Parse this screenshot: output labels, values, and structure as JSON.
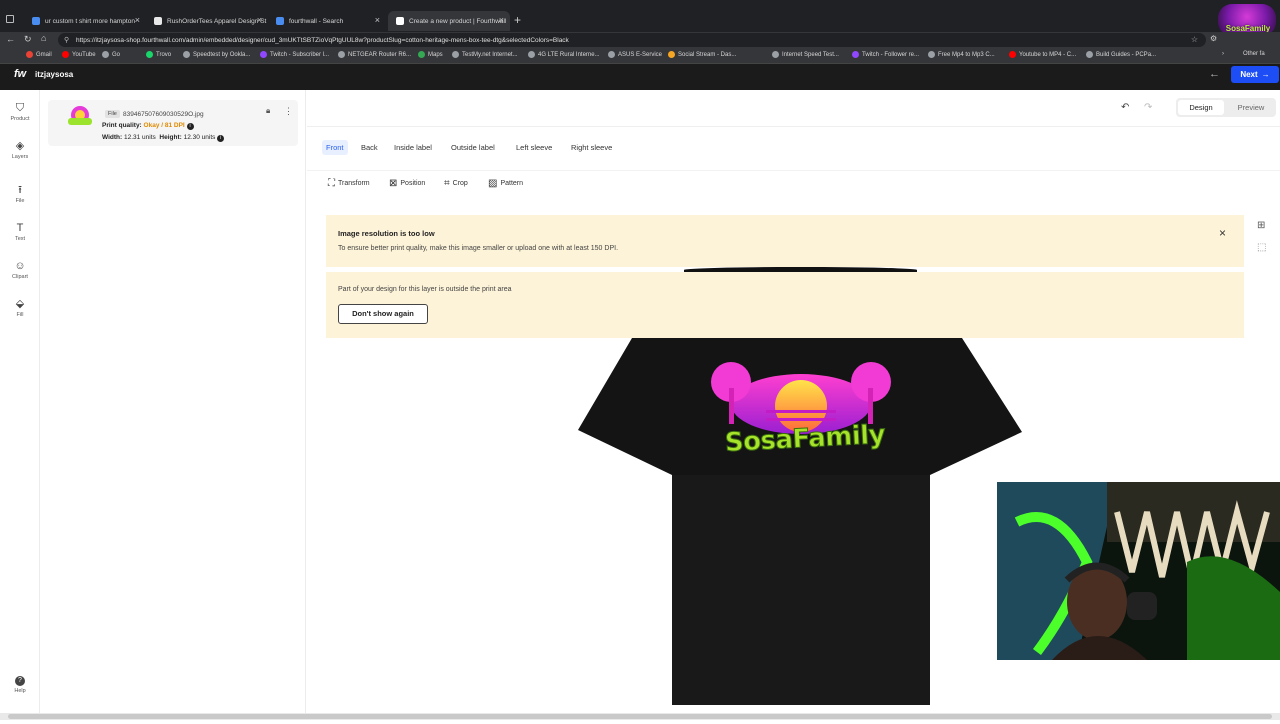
{
  "browser": {
    "tabs": [
      {
        "label": "ur custom t shirt more hampton",
        "color": "#4a8df0"
      },
      {
        "label": "RushOrderTees Apparel Design St",
        "color": "#e8e8e8"
      },
      {
        "label": "fourthwall - Search",
        "color": "#4a8df0"
      },
      {
        "label": "Create a new product | Fourthwall",
        "color": "#ffffff"
      }
    ],
    "url": "https://itzjaysosa-shop.fourthwall.com/admin/embedded/designer/cud_3mUKTtSBTZioVqPtgUUL8w?productSlug=cotton-heritage-mens-box-tee-dtg&selectedColors=Black",
    "bookmarks": [
      {
        "label": "Gmail",
        "color": "#ea4335"
      },
      {
        "label": "YouTube",
        "color": "#ff0000"
      },
      {
        "label": "Go",
        "color": "#9aa0a6"
      },
      {
        "label": "Trovo",
        "color": "#19d66b"
      },
      {
        "label": "Speedtest by Ookla...",
        "color": "#9aa0a6"
      },
      {
        "label": "Twitch - Subscriber l...",
        "color": "#9147ff"
      },
      {
        "label": "NETGEAR Router R6...",
        "color": "#9aa0a6"
      },
      {
        "label": "Maps",
        "color": "#34a853"
      },
      {
        "label": "TestMy.net Internet...",
        "color": "#9aa0a6"
      },
      {
        "label": "4G LTE Rural Interne...",
        "color": "#9aa0a6"
      },
      {
        "label": "ASUS E-Service",
        "color": "#9aa0a6"
      },
      {
        "label": "Social Stream - Das...",
        "color": "#f5a623"
      },
      {
        "label": "Internet Speed Test...",
        "color": "#9aa0a6"
      },
      {
        "label": "Twitch - Follower re...",
        "color": "#9147ff"
      },
      {
        "label": "Free Mp4 to Mp3 C...",
        "color": "#9aa0a6"
      },
      {
        "label": "Youtube to MP4 - C...",
        "color": "#ff0000"
      },
      {
        "label": "Build Guides - PCPa...",
        "color": "#9aa0a6"
      }
    ],
    "other_bookmarks": "Other fa"
  },
  "app": {
    "logo": "fw",
    "store_name": "itzjaysosa",
    "next_label": "Next",
    "next_color": "#1d4ef5"
  },
  "nav": [
    {
      "label": "Product",
      "icon": "shirt-icon",
      "glyph": "⛉"
    },
    {
      "label": "Layers",
      "icon": "layers-icon",
      "glyph": "◈"
    },
    {
      "label": "File",
      "icon": "upload-icon",
      "glyph": "⭱"
    },
    {
      "label": "Text",
      "icon": "text-icon",
      "glyph": "T"
    },
    {
      "label": "Clipart",
      "icon": "smiley-icon",
      "glyph": "☺"
    },
    {
      "label": "Fill",
      "icon": "paint-bucket-icon",
      "glyph": "⬙"
    },
    {
      "label": "Help",
      "icon": "help-icon",
      "glyph": "?"
    }
  ],
  "layer": {
    "badge": "File",
    "filename": "839467507609030529O.jpg",
    "quality_label": "Print quality:",
    "quality_value": "Okay / 81 DPI",
    "quality_color": "#e08a00",
    "width_label": "Width:",
    "width_value": "12.31 units",
    "height_label": "Height:",
    "height_value": "12.30 units"
  },
  "toolbar": {
    "design": "Design",
    "preview": "Preview"
  },
  "sides": [
    "Front",
    "Back",
    "Inside label",
    "Outside label",
    "Left sleeve",
    "Right sleeve"
  ],
  "tools": [
    "Transform",
    "Position",
    "Crop",
    "Pattern"
  ],
  "warning1": {
    "title": "Image resolution is too low",
    "body": "To ensure better print quality, make this image smaller or upload one with at least 150 DPI."
  },
  "warning2": {
    "body": "Part of your design for this layer is outside the print area",
    "button": "Don't show again"
  },
  "design": {
    "text": "SosaFamily"
  },
  "overlay": {
    "corner_logo": "SosaFamily"
  }
}
